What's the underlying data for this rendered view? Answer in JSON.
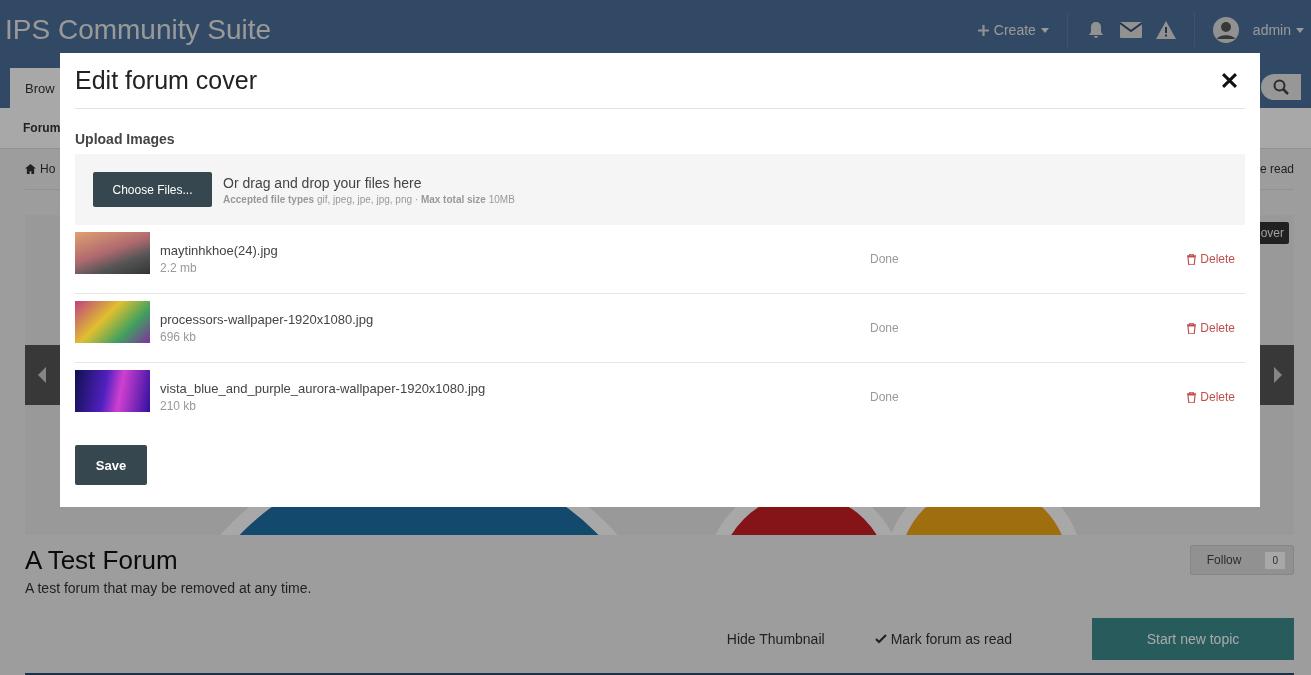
{
  "header": {
    "title": "IPS Community Suite",
    "create": "Create",
    "user": "admin"
  },
  "nav": {
    "tab": "Brow",
    "subtab": "Forum"
  },
  "breadcrumb": {
    "home": "Ho",
    "right": "e read"
  },
  "cover": {
    "badge": "over"
  },
  "forum": {
    "title": "A Test Forum",
    "description": "A test forum that may be removed at any time.",
    "follow": "Follow",
    "follow_count": "0",
    "hide_thumbnail": "Hide Thumbnail",
    "mark_read": "Mark forum as read",
    "start_topic": "Start new topic"
  },
  "modal": {
    "title": "Edit forum cover",
    "section": "Upload Images",
    "choose": "Choose Files...",
    "drop_hint": "Or drag and drop your files here",
    "accepted": "**Accepted file types** gif, jpeg, jpe, jpg, png · **Max total size** 10MB",
    "files": [
      {
        "name": "maytinhkhoe(24).jpg",
        "size": "2.2 mb",
        "status": "Done",
        "action": "Delete"
      },
      {
        "name": "processors-wallpaper-1920x1080.jpg",
        "size": "696 kb",
        "status": "Done",
        "action": "Delete"
      },
      {
        "name": "vista_blue_and_purple_aurora-wallpaper-1920x1080.jpg",
        "size": "210 kb",
        "status": "Done",
        "action": "Delete"
      }
    ],
    "save": "Save"
  }
}
